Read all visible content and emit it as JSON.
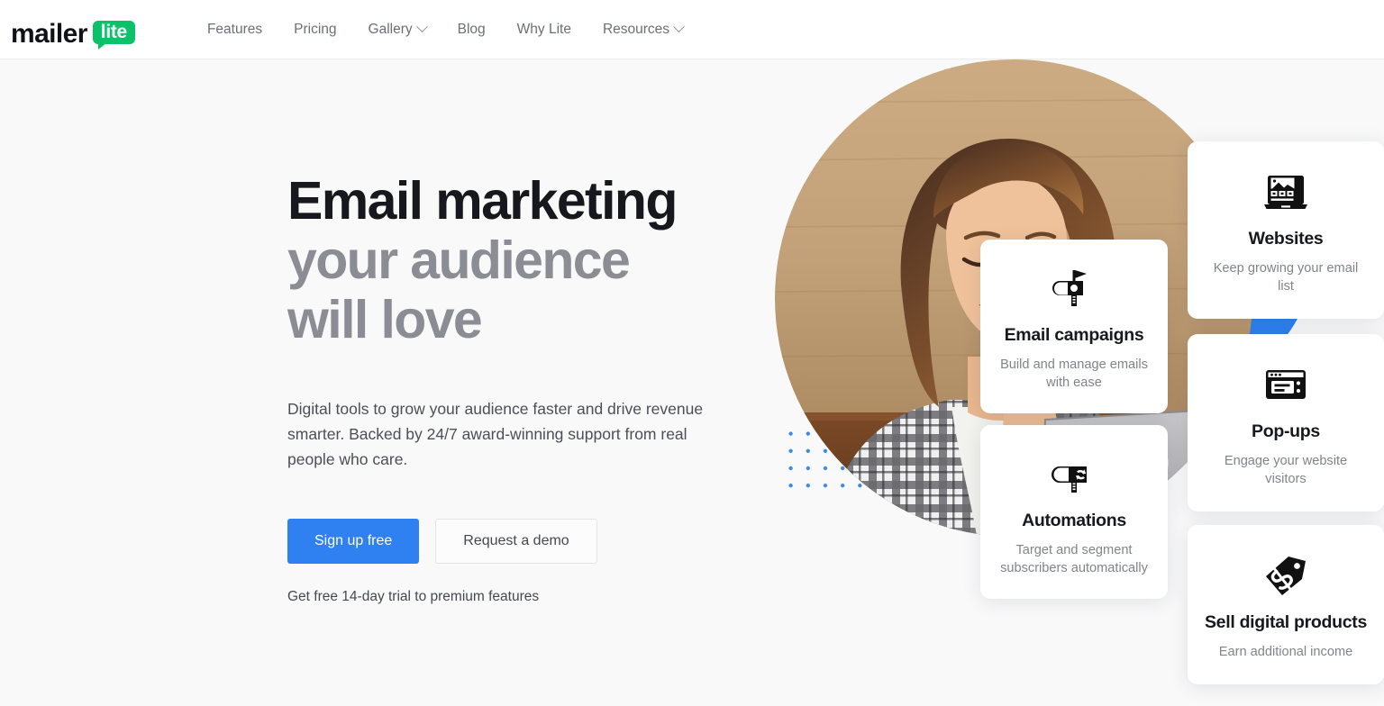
{
  "brand": {
    "name_primary": "mailer",
    "name_badge": "lite",
    "badge_color": "#09c269"
  },
  "nav": {
    "items": [
      {
        "label": "Features",
        "has_dropdown": false
      },
      {
        "label": "Pricing",
        "has_dropdown": false
      },
      {
        "label": "Gallery",
        "has_dropdown": true
      },
      {
        "label": "Blog",
        "has_dropdown": false
      },
      {
        "label": "Why Lite",
        "has_dropdown": false
      },
      {
        "label": "Resources",
        "has_dropdown": true
      }
    ]
  },
  "hero": {
    "heading_line1": "Email marketing",
    "heading_line2": "your audience",
    "heading_line3": "will love",
    "paragraph": "Digital tools to grow your audience faster and drive revenue smarter. Backed by 24/7 award-winning support from real people who care.",
    "primary_cta": "Sign up free",
    "secondary_cta": "Request a demo",
    "trial_note": "Get free 14-day trial to premium features",
    "accent_color": "#2f80f0",
    "heading_dark_color": "#16181d",
    "heading_light_color": "#8a8d93"
  },
  "cards": [
    {
      "id": "email-campaigns",
      "icon": "mailbox-flag-icon",
      "title": "Email campaigns",
      "subtitle": "Build and manage emails with ease"
    },
    {
      "id": "automations",
      "icon": "mailbox-refresh-icon",
      "title": "Automations",
      "subtitle": "Target and segment subscribers automatically"
    },
    {
      "id": "websites",
      "icon": "laptop-website-icon",
      "title": "Websites",
      "subtitle": "Keep growing your email list"
    },
    {
      "id": "pop-ups",
      "icon": "browser-window-icon",
      "title": "Pop-ups",
      "subtitle": "Engage your website visitors"
    },
    {
      "id": "sell-digital-products",
      "icon": "price-tag-dollar-icon",
      "title": "Sell digital products",
      "subtitle": "Earn additional income"
    }
  ],
  "decor": {
    "blue_circle_color": "#2f80f0",
    "dot_grid_color": "#3d8be0",
    "photo_alt": "Smiling woman with curly hair working on a sticker-covered laptop at a wooden desk"
  }
}
